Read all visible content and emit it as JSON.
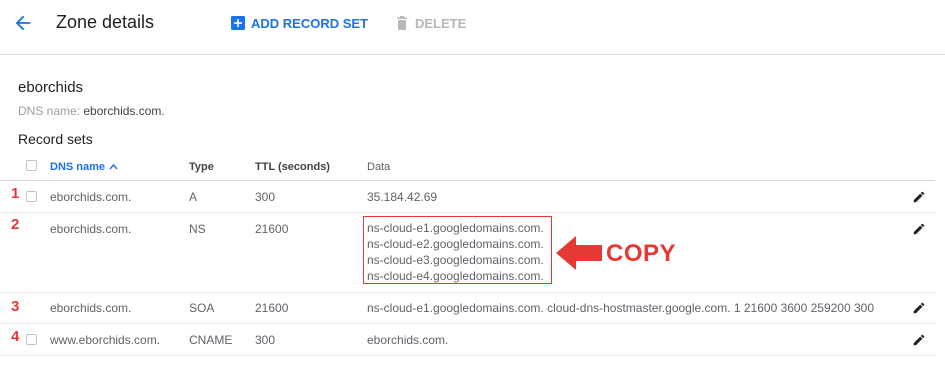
{
  "header": {
    "title": "Zone details",
    "add_record_set_label": "ADD RECORD SET",
    "delete_label": "DELETE"
  },
  "zone": {
    "name": "eborchids",
    "dns_label": "DNS name:",
    "dns_value": "eborchids.com."
  },
  "record_sets": {
    "heading": "Record sets",
    "columns": {
      "dns_name": "DNS name",
      "type": "Type",
      "ttl": "TTL (seconds)",
      "data": "Data"
    },
    "rows": [
      {
        "dns": "eborchids.com.",
        "type": "A",
        "ttl": "300",
        "data": "35.184.42.69"
      },
      {
        "dns": "eborchids.com.",
        "type": "NS",
        "ttl": "21600",
        "data_lines": [
          "ns-cloud-e1.googledomains.com.",
          "ns-cloud-e2.googledomains.com.",
          "ns-cloud-e3.googledomains.com.",
          "ns-cloud-e4.googledomains.com."
        ]
      },
      {
        "dns": "eborchids.com.",
        "type": "SOA",
        "ttl": "21600",
        "data": "ns-cloud-e1.googledomains.com. cloud-dns-hostmaster.google.com. 1 21600 3600 259200 300"
      },
      {
        "dns": "www.eborchids.com.",
        "type": "CNAME",
        "ttl": "300",
        "data": "eborchids.com."
      }
    ]
  },
  "annotations": {
    "row_numbers": [
      "1",
      "2",
      "3",
      "4"
    ],
    "copy_label": "COPY",
    "color": "#e53935"
  },
  "colors": {
    "accent": "#1a73e8"
  }
}
